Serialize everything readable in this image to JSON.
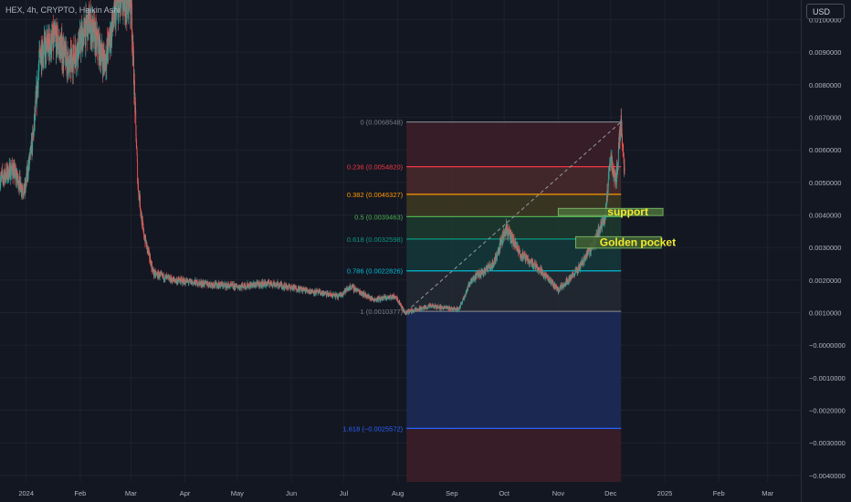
{
  "header": {
    "symbol": "HEX, 4h, CRYPTO, Heikin Ashi",
    "currency": "USD"
  },
  "chart_data": {
    "type": "candlestick",
    "ylim": [
      -0.0042,
      0.0106
    ],
    "y_ticks": [
      {
        "value": 0.01,
        "label": "0.0100000"
      },
      {
        "value": 0.009,
        "label": "0.0090000"
      },
      {
        "value": 0.008,
        "label": "0.0080000"
      },
      {
        "value": 0.007,
        "label": "0.0070000"
      },
      {
        "value": 0.006,
        "label": "0.0060000"
      },
      {
        "value": 0.005,
        "label": "0.0050000"
      },
      {
        "value": 0.004,
        "label": "0.0040000"
      },
      {
        "value": 0.003,
        "label": "0.0030000"
      },
      {
        "value": 0.002,
        "label": "0.0020000"
      },
      {
        "value": 0.001,
        "label": "0.0010000"
      },
      {
        "value": 0.0,
        "label": "−0.0000000"
      },
      {
        "value": -0.001,
        "label": "−0.0010000"
      },
      {
        "value": -0.002,
        "label": "−0.0020000"
      },
      {
        "value": -0.003,
        "label": "−0.0030000"
      },
      {
        "value": -0.004,
        "label": "−0.0040000"
      }
    ],
    "x_range": [
      "2023-12-17",
      "2025-03-20"
    ],
    "x_ticks": [
      {
        "date": "2024-01-01",
        "label": "2024"
      },
      {
        "date": "2024-02-01",
        "label": "Feb"
      },
      {
        "date": "2024-03-01",
        "label": "Mar"
      },
      {
        "date": "2024-04-01",
        "label": "Apr"
      },
      {
        "date": "2024-05-01",
        "label": "May"
      },
      {
        "date": "2024-06-01",
        "label": "Jun"
      },
      {
        "date": "2024-07-01",
        "label": "Jul"
      },
      {
        "date": "2024-08-01",
        "label": "Aug"
      },
      {
        "date": "2024-09-01",
        "label": "Sep"
      },
      {
        "date": "2024-10-01",
        "label": "Oct"
      },
      {
        "date": "2024-11-01",
        "label": "Nov"
      },
      {
        "date": "2024-12-01",
        "label": "Dec"
      },
      {
        "date": "2025-01-01",
        "label": "2025"
      },
      {
        "date": "2025-02-01",
        "label": "Feb"
      },
      {
        "date": "2025-03-01",
        "label": "Mar"
      }
    ],
    "price_path": [
      [
        "2023-12-17",
        0.0051
      ],
      [
        "2023-12-24",
        0.0054
      ],
      [
        "2023-12-31",
        0.0047
      ],
      [
        "2024-01-05",
        0.0064
      ],
      [
        "2024-01-09",
        0.009
      ],
      [
        "2024-01-18",
        0.0094
      ],
      [
        "2024-01-26",
        0.0086
      ],
      [
        "2024-02-06",
        0.0099
      ],
      [
        "2024-02-15",
        0.0087
      ],
      [
        "2024-02-22",
        0.0104
      ],
      [
        "2024-03-01",
        0.0107
      ],
      [
        "2024-03-05",
        0.005
      ],
      [
        "2024-03-08",
        0.0035
      ],
      [
        "2024-03-14",
        0.0022
      ],
      [
        "2024-03-25",
        0.002
      ],
      [
        "2024-04-10",
        0.0019
      ],
      [
        "2024-05-01",
        0.0018
      ],
      [
        "2024-05-20",
        0.0019
      ],
      [
        "2024-06-08",
        0.0017
      ],
      [
        "2024-06-28",
        0.0015
      ],
      [
        "2024-07-05",
        0.0018
      ],
      [
        "2024-07-18",
        0.0014
      ],
      [
        "2024-07-31",
        0.0015
      ],
      [
        "2024-08-05",
        0.001
      ],
      [
        "2024-08-20",
        0.0012
      ],
      [
        "2024-09-05",
        0.0011
      ],
      [
        "2024-09-12",
        0.002
      ],
      [
        "2024-09-25",
        0.0025
      ],
      [
        "2024-10-02",
        0.0036
      ],
      [
        "2024-10-10",
        0.0028
      ],
      [
        "2024-10-20",
        0.0024
      ],
      [
        "2024-11-01",
        0.0017
      ],
      [
        "2024-11-12",
        0.0023
      ],
      [
        "2024-11-22",
        0.0032
      ],
      [
        "2024-11-28",
        0.004
      ],
      [
        "2024-12-01",
        0.0058
      ],
      [
        "2024-12-04",
        0.005
      ],
      [
        "2024-12-07",
        0.0069
      ],
      [
        "2024-12-09",
        0.0053
      ]
    ],
    "fibonacci": {
      "start_date": "2024-08-06",
      "end_date": "2024-12-07",
      "levels": [
        {
          "ratio": "0",
          "price": 0.0068548,
          "label": "0 (0.0068548)",
          "color": "#787b86",
          "fill": "#3d1f28"
        },
        {
          "ratio": "0.236",
          "price": 0.005482,
          "label": "0.236 (0.0054820)",
          "color": "#f23645",
          "fill": "#4a2a2a"
        },
        {
          "ratio": "0.382",
          "price": 0.0046327,
          "label": "0.382 (0.0046327)",
          "color": "#ff9800",
          "fill": "#3f3a22"
        },
        {
          "ratio": "0.5",
          "price": 0.0039463,
          "label": "0.5 (0.0039463)",
          "color": "#4caf50",
          "fill": "#1f3b2e"
        },
        {
          "ratio": "0.618",
          "price": 0.0032598,
          "label": "0.618 (0.0032598)",
          "color": "#089981",
          "fill": "#14383a"
        },
        {
          "ratio": "0.786",
          "price": 0.0022826,
          "label": "0.786 (0.0022826)",
          "color": "#00bcd4",
          "fill": "#252a33"
        },
        {
          "ratio": "1",
          "price": 0.0010377,
          "label": "1 (0.0010377)",
          "color": "#787b86",
          "fill": "#1c2b5a"
        },
        {
          "ratio": "1.618",
          "price": -0.0025572,
          "label": "1.618 (−0.0025572)",
          "color": "#2962ff",
          "fill": "#3d1f28"
        }
      ]
    },
    "bottom_value": -0.0042,
    "annotations": [
      {
        "text": "support",
        "price_top": 0.0042,
        "price_bottom": 0.00398,
        "date_start": "2024-11-01",
        "date_end": "2024-12-31",
        "color": "#f2ea2f",
        "box_fill": "#4a6b3a",
        "box_stroke": "#7ec06a"
      },
      {
        "text": "Golden pocket",
        "price_top": 0.00333,
        "price_bottom": 0.00298,
        "date_start": "2024-11-11",
        "date_end": "2024-12-30",
        "color": "#f2ea2f",
        "box_fill": "#3f5d32",
        "box_stroke": "#7ec06a"
      }
    ],
    "colors": {
      "up": "#26a69a",
      "down": "#ef5350",
      "grid": "#1e222d",
      "axis_text": "#b2b5be"
    }
  }
}
